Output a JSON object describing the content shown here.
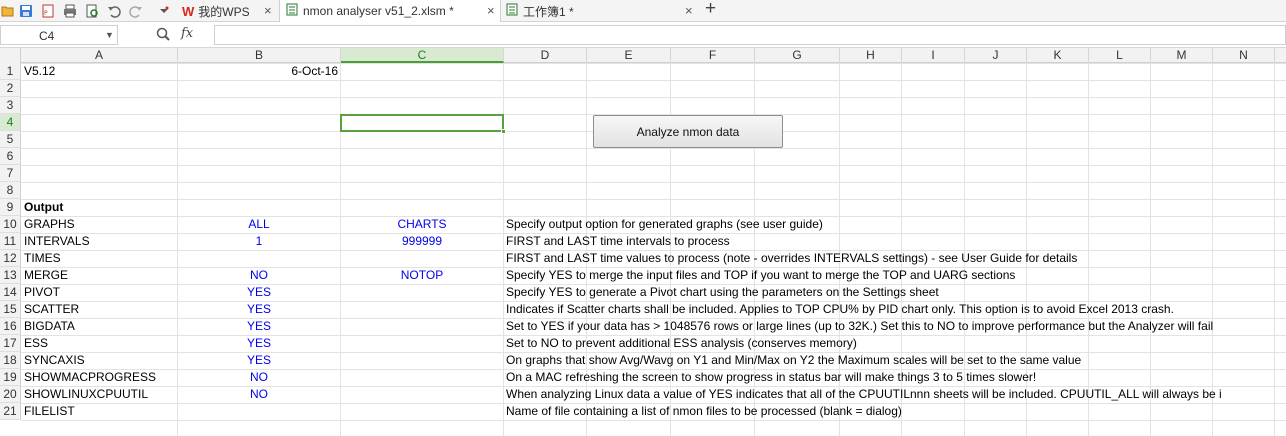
{
  "tabs": [
    {
      "label": "我的WPS",
      "close": "×"
    },
    {
      "label": "nmon analyser v51_2.xlsm *",
      "close": "×"
    },
    {
      "label": "工作簿1 *",
      "close": "×"
    }
  ],
  "new_tab": "+",
  "formula_bar": {
    "cell_ref": "C4",
    "fx_label": "fx",
    "formula_value": ""
  },
  "columns": [
    "A",
    "B",
    "C",
    "D",
    "E",
    "F",
    "G",
    "H",
    "I",
    "J",
    "K",
    "L",
    "M",
    "N"
  ],
  "selected_column": "C",
  "rows": [
    "1",
    "2",
    "3",
    "4",
    "5",
    "6",
    "7",
    "8",
    "9",
    "10",
    "11",
    "12",
    "13",
    "14",
    "15",
    "16",
    "17",
    "18",
    "19",
    "20",
    "21"
  ],
  "selected_row": "4",
  "button": {
    "label": "Analyze nmon data"
  },
  "cells": {
    "A1": "V5.12",
    "B1": "6-Oct-16",
    "A9": "Output",
    "A10": "GRAPHS",
    "B10": "ALL",
    "C10": "CHARTS",
    "D10": "Specify output option for generated graphs (see user guide)",
    "A11": "INTERVALS",
    "B11": "1",
    "C11": "999999",
    "D11": "FIRST and LAST time intervals to process",
    "A12": "TIMES",
    "D12": "FIRST and LAST time values to process (note - overrides INTERVALS settings) - see User Guide for details",
    "A13": "MERGE",
    "B13": "NO",
    "C13": "NOTOP",
    "D13": "Specify YES to merge the input files and TOP if you want to merge the TOP and UARG sections",
    "A14": "PIVOT",
    "B14": "YES",
    "D14": "Specify YES to generate a Pivot chart using the parameters on the Settings sheet",
    "A15": "SCATTER",
    "B15": "YES",
    "D15": "Indicates if Scatter charts shall be included.  Applies to TOP CPU% by PID chart only.  This option is to avoid Excel 2013 crash.",
    "A16": "BIGDATA",
    "B16": "YES",
    "D16": "Set to YES if your data has > 1048576 rows or large lines (up to 32K.)  Set this to NO to improve performance but the Analyzer will fail",
    "A17": "ESS",
    "B17": "YES",
    "D17": "Set to NO to prevent additional ESS analysis (conserves memory)",
    "A18": "SYNCAXIS",
    "B18": "YES",
    "D18": "On graphs that show Avg/Wavg on Y1 and Min/Max on Y2 the Maximum scales will be set to the same value",
    "A19": "SHOWMACPROGRESS",
    "B19": "NO",
    "D19": "On a MAC refreshing the screen to show progress in status bar will make things 3 to 5 times slower!",
    "A20": "SHOWLINUXCPUUTIL",
    "B20": "NO",
    "D20": "When analyzing Linux data a value of YES indicates that all of the CPUUTILnnn sheets will be included.  CPUUTIL_ALL will always be i",
    "A21": "FILELIST",
    "D21": "Name of file containing a list of nmon files to be processed (blank = dialog)"
  },
  "colors": {
    "value_blue": "#0000ee",
    "selection_green": "#5aa03c",
    "wps_red": "#d9261c"
  }
}
